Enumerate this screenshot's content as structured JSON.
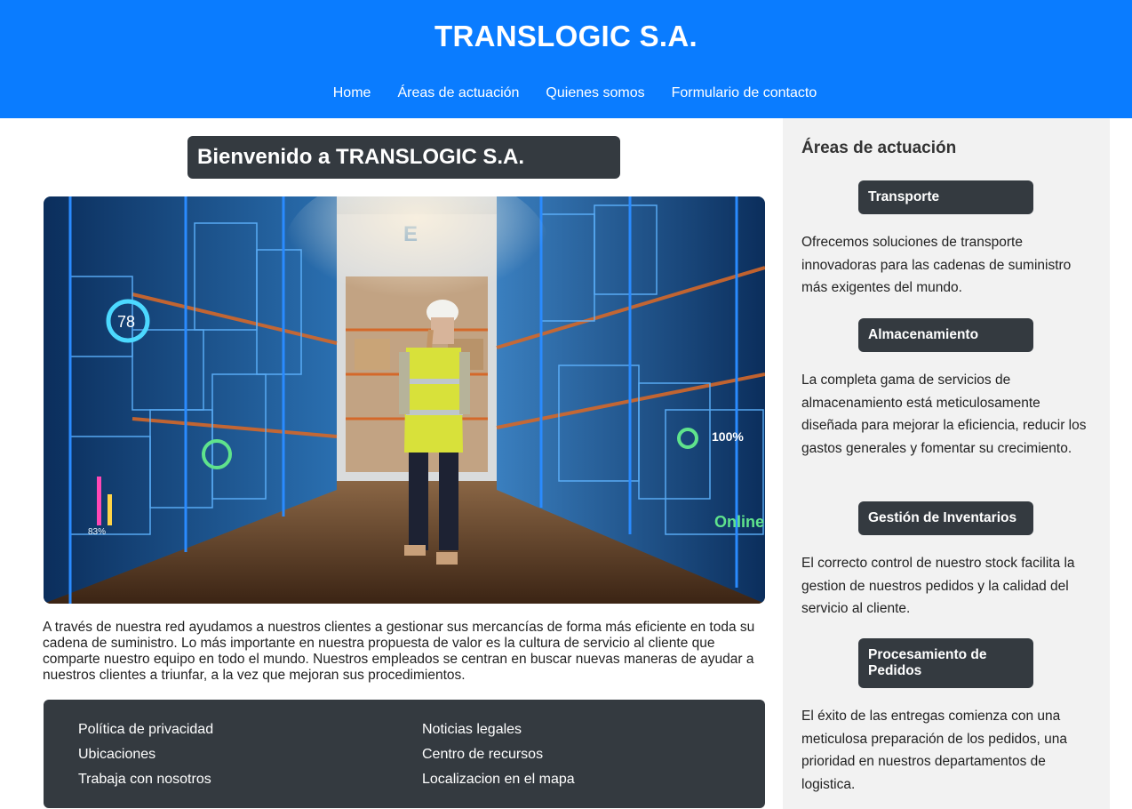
{
  "header": {
    "title": "TRANSLOGIC S.A.",
    "nav": [
      "Home",
      "Áreas de actuación",
      "Quienes somos",
      "Formulario de contacto"
    ]
  },
  "main": {
    "welcome": "Bienvenido a TRANSLOGIC S.A.",
    "hero_image": {
      "overlay_labels": [
        "78",
        "E",
        "100%",
        "Online",
        "83%"
      ]
    },
    "intro": "A través de nuestra red ayudamos a nuestros clientes a gestionar sus mercancías de forma más eficiente en toda su cadena de suministro. Lo más importante en nuestra propuesta de valor es la cultura de servicio al cliente que comparte nuestro equipo en todo el mundo. Nuestros empleados se centran en buscar nuevas maneras de ayudar a nuestros clientes a triunfar, a la vez que mejoran sus procedimientos."
  },
  "footer": {
    "col1": [
      "Política de privacidad",
      "Ubicaciones",
      "Trabaja con nosotros"
    ],
    "col2": [
      "Noticias legales",
      "Centro de recursos",
      "Localizacion en el mapa"
    ]
  },
  "sidebar": {
    "title": "Áreas de actuación",
    "areas": [
      {
        "name": "Transporte",
        "text": "Ofrecemos soluciones de transporte innovadoras para las cadenas de suministro más exigentes del mundo."
      },
      {
        "name": "Almacenamiento",
        "text": "La completa gama de servicios de almacenamiento está meticulosamente diseñada para mejorar la eficiencia, reducir los gastos generales y fomentar su crecimiento."
      },
      {
        "name": "Gestión de Inventarios",
        "text": "El correcto control de nuestro stock facilita la gestion de nuestros pedidos y la calidad del servicio al cliente."
      },
      {
        "name": "Procesamiento de Pedidos",
        "text": "El éxito de las entregas comienza con una meticulosa preparación de los pedidos, una prioridad en nuestros departamentos de logistica."
      }
    ]
  },
  "colors": {
    "header_bg": "#0a7cff",
    "dark_panel": "#343a40",
    "sidebar_bg": "#f2f2f2"
  }
}
